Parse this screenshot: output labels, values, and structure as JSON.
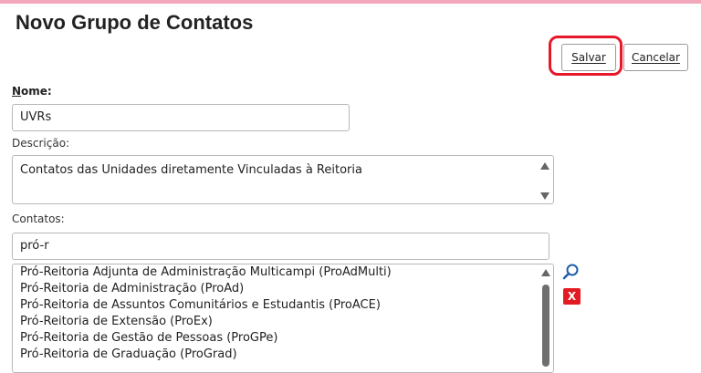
{
  "page": {
    "title": "Novo Grupo de Contatos"
  },
  "toolbar": {
    "save_label": "Salvar",
    "cancel_label": "Cancelar"
  },
  "form": {
    "nome": {
      "label_first": "N",
      "label_rest": "ome:",
      "value": "UVRs"
    },
    "descricao": {
      "label": "Descrição:",
      "value": "Contatos das Unidades diretamente Vinculadas à Reitoria"
    },
    "contatos": {
      "label": "Contatos:",
      "search_value": "pró-r",
      "results": [
        "Pró-Reitoria Adjunta de Administração Multicampi (ProAdMulti)",
        "Pró-Reitoria de Administração (ProAd)",
        "Pró-Reitoria de Assuntos Comunitários e Estudantis (ProACE)",
        "Pró-Reitoria de Extensão (ProEx)",
        "Pró-Reitoria de Gestão de Pessoas (ProGPe)",
        "Pró-Reitoria de Graduação (ProGrad)"
      ]
    }
  },
  "icons": {
    "search": "search-icon",
    "remove": "remove-icon",
    "remove_glyph": "X"
  },
  "colors": {
    "accent_bar": "#f3a7bb",
    "highlight": "#e8182a",
    "remove_bg": "#e21b23"
  }
}
